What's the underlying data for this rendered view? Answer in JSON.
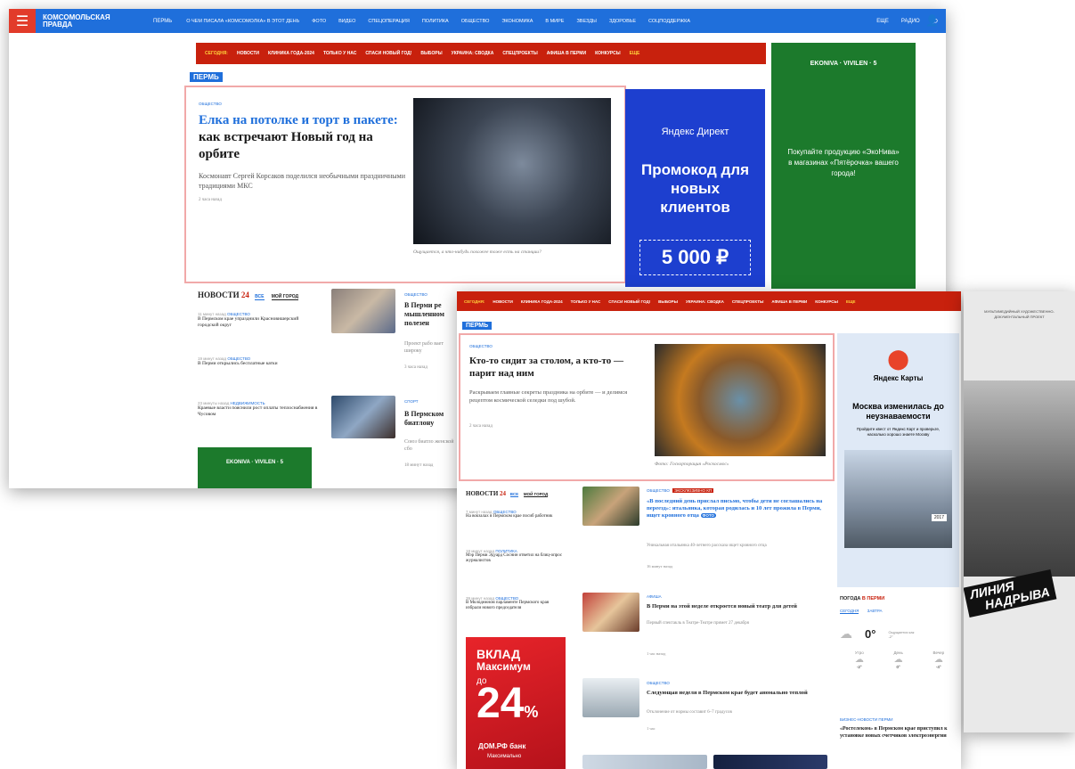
{
  "topbar": {
    "logo_line1": "КОМСОМОЛЬСКАЯ",
    "logo_line2": "ПРАВДА",
    "city": "ПЕРМЬ",
    "nav": [
      "О ЧЕМ ПИСАЛА «КОМСОМОЛКА» В ЭТОТ ДЕНЬ",
      "ФОТО",
      "ВИДЕО",
      "СПЕЦОПЕРАЦИЯ",
      "ПОЛИТИКА",
      "ОБЩЕСТВО",
      "ЭКОНОМИКА",
      "В МИРЕ",
      "ЗВЕЗДЫ",
      "ЗДОРОВЬЕ",
      "СОЦПОДДЕРЖКА"
    ],
    "more": "ЕЩЕ",
    "radio": "РАДИО"
  },
  "subnav": {
    "today": "СЕГОДНЯ:",
    "items": [
      "НОВОСТИ",
      "КЛИНИКА ГОДА-2024",
      "ТОЛЬКО У НАС",
      "СПАСИ НОВЫЙ ГОД!",
      "ВЫБОРЫ",
      "УКРАИНА: СВОДКА",
      "СПЕЦПРОЕКТЫ",
      "АФИША В ПЕРМИ",
      "КОНКУРСЫ"
    ],
    "more": "ЕЩЕ"
  },
  "region_label": "ПЕРМЬ",
  "shot1": {
    "lead": {
      "tag": "ОБЩЕСТВО",
      "title_blue": "Елка на потолке и торт в пакете:",
      "title_rest": "как встречают Новый год на орбите",
      "lead_text": "Космонавт Сергей Корсаков поделился необычными праздничными традициями МКС",
      "meta": "2 часа назад",
      "caption": "Ощущается, а что-нибудь похожее тоже есть на станции?"
    },
    "ad_direct": {
      "brand": "Яндекс Директ",
      "headline": "Промокод для новых клиентов",
      "amount": "5 000 ₽"
    },
    "ad_ekoniva": {
      "logos": "EKONIVA · VIVILEN · 5",
      "text": "Покупайте продукцию «ЭкоНива» в магазинах «Пятёрочка» вашего города!"
    },
    "news": {
      "header": "НОВОСТИ",
      "header_num": "24",
      "tab_all": "ВСЕ",
      "tab_city": "МОЙ ГОРОД",
      "items": [
        {
          "time": "11 минут назад",
          "tag": "ОБЩЕСТВО",
          "text": "В Пермском крае упразднили Красновишерский городской округ"
        },
        {
          "time": "19 минут назад",
          "tag": "ОБЩЕСТВО",
          "text": "В Перми открылись бесплатные катки"
        },
        {
          "time": "23 минуты назад",
          "tag": "НЕДВИЖИМОСТЬ",
          "text": "Краевые власти пояснили рост оплаты теплоснабжения в Чусовом"
        }
      ]
    },
    "cards": [
      {
        "tag": "ОБЩЕСТВО",
        "title": "В Перми ре мышленном полезен",
        "text": "Проект рабо вает широку",
        "meta": "3 часа назад"
      },
      {
        "tag": "СПОРТ",
        "title": "В Пермском биатлону",
        "text": "Союз биатло женской сбо",
        "meta": "18 минут назад"
      }
    ]
  },
  "shot2": {
    "lead": {
      "tag": "ОБЩЕСТВО",
      "title": "Кто-то сидит за столом, а кто-то — парит над ним",
      "lead_text": "Раскрываем главные секреты праздника на орбите — и делимся рецептом космической селедки под шубой.",
      "meta": "2 часа назад",
      "caption": "Фото: Госкорпорация «Роскосмос»"
    },
    "ad_maps": {
      "brand": "Яндекс Карты",
      "headline": "Москва изменилась до неузнаваемости",
      "text": "Пройдите квест от Яндекс Карт и проверьте, насколько хорошо знаете Москву",
      "year": "2017"
    },
    "news": {
      "header": "НОВОСТИ",
      "header_num": "24",
      "tab_all": "ВСЕ",
      "tab_city": "МОЙ ГОРОД",
      "items": [
        {
          "time": "7 минут назад",
          "tag": "ОБЩЕСТВО",
          "text": "На вокзалах в Пермском крае посиб работник"
        },
        {
          "time": "18 минут назад",
          "tag": "ПОЛИТИКА",
          "text": "Мэр Перми Эдуард Соснин ответил на блиц-опрос журналистов"
        },
        {
          "time": "39 минут назад",
          "tag": "ОБЩЕСТВО",
          "text": "В Молодежном парламенте Пермского края избрали нового председателя"
        }
      ]
    },
    "ad_bank": {
      "line1": "ВКЛАД",
      "line2": "Максимум",
      "line3": "до",
      "rate": "24",
      "pct": "%",
      "brand": "ДОМ.РФ банк",
      "foot": "Максимально"
    },
    "cards": [
      {
        "tag": "ОБЩЕСТВО",
        "tag2": "ЭКСКЛЮЗИВНО КП",
        "title": "«В последний день прислал письмо, чтобы дети не соглашались на переезд»: итальянка, которая родилась и 10 лет прожила в Перми, ищет кровного отца",
        "badge": "ФОТО",
        "text": "Уникальная итальянка 40-летнего рассказа ищет кровного отца",
        "meta": "16 минут назад"
      },
      {
        "tag": "АФИША",
        "title": "В Перми на этой неделе откроется новый театр для детей",
        "text": "Первый спектакль в Театре-Театре примет 27 декабря",
        "meta": "1 час назад"
      },
      {
        "tag": "ОБЩЕСТВО",
        "title": "Следующая неделя в Пермском крае будет аномально теплой",
        "text": "Отклонение от нормы составит 6–7 градусов",
        "meta": "1 час"
      }
    ],
    "weather": {
      "header_a": "ПОГОДА",
      "header_b": "В ПЕРМИ",
      "tab_today": "СЕГОДНЯ",
      "tab_tomorrow": "ЗАВТРА",
      "temp": "0°",
      "desc": "Ощущается как -2°",
      "periods": [
        {
          "label": "Утро",
          "temp": "-2°"
        },
        {
          "label": "День",
          "temp": "0°"
        },
        {
          "label": "Вечер",
          "temp": "-4°"
        }
      ]
    },
    "bottom_news": {
      "tag": "БИЗНЕС-НОВОСТИ ПЕРМИ",
      "text": "«Ростелеком» в Пермском крае приступил к установке новых счетчиков электроэнергии"
    }
  },
  "shot3": {
    "top": "МУЛЬТИМЕДИЙНЫЙ ХУДОЖЕСТВЕННО-ДОКУМЕНТАЛЬНЫЙ ПРОЕКТ",
    "title1": "ЛИНИЯ",
    "title2": "НАДРЫВА"
  },
  "colors": {
    "brand_blue": "#1f6fdb",
    "accent_red": "#c8210d",
    "highlight_border": "#f1a9a9"
  }
}
